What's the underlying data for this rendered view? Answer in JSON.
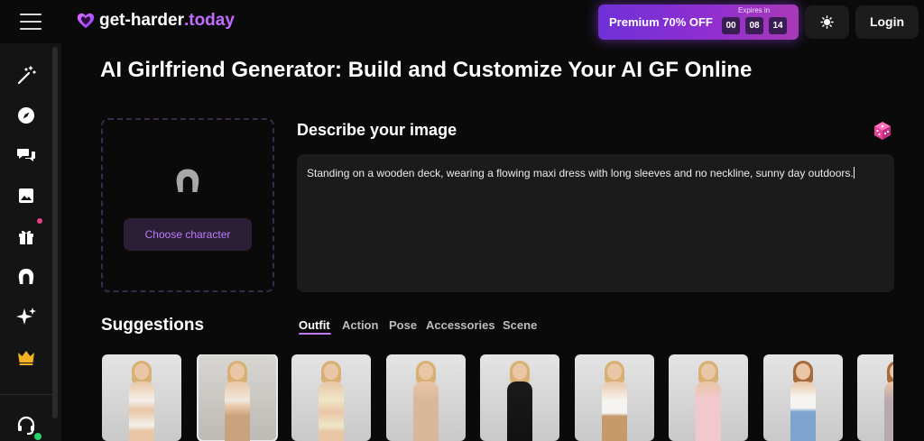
{
  "header": {
    "logo_text_a": "get-harder",
    "logo_text_b": ".today",
    "premium_label": "Premium 70% OFF",
    "expires_label": "Expires in",
    "countdown": [
      "00",
      "08",
      "14"
    ],
    "login_label": "Login",
    "icons": {
      "menu": "hamburger-icon",
      "theme": "sun-icon"
    }
  },
  "sidebar": {
    "items": [
      {
        "icon": "magic-wand-icon"
      },
      {
        "icon": "compass-icon"
      },
      {
        "icon": "chat-icon"
      },
      {
        "icon": "image-icon"
      },
      {
        "icon": "gift-icon",
        "has_notification": true
      },
      {
        "icon": "character-icon"
      },
      {
        "icon": "sparkles-icon"
      },
      {
        "icon": "crown-icon"
      }
    ],
    "support_icon": "headset-icon"
  },
  "main": {
    "title": "AI Girlfriend Generator: Build and Customize Your AI GF Online",
    "choose_character_label": "Choose character",
    "describe_title": "Describe your image",
    "prompt_value": "Standing on a wooden deck, wearing a flowing maxi dress with long sleeves and no neckline, sunny day outdoors.",
    "suggestions_title": "Suggestions",
    "tabs": [
      {
        "label": "Outfit",
        "active": true
      },
      {
        "label": "Action"
      },
      {
        "label": "Pose"
      },
      {
        "label": "Accessories"
      },
      {
        "label": "Scene"
      }
    ],
    "thumbnails": [
      {
        "outfit": "white-lingerie",
        "selected": false
      },
      {
        "outfit": "beige-shapewear",
        "selected": true
      },
      {
        "outfit": "cream-lace-lingerie",
        "selected": false
      },
      {
        "outfit": "nude-off-shoulder",
        "selected": false
      },
      {
        "outfit": "black-latex-suit",
        "selected": false
      },
      {
        "outfit": "white-crop-tan-skirt",
        "selected": false
      },
      {
        "outfit": "pink-satin-robe",
        "selected": false
      },
      {
        "outfit": "white-top-blue-jeans",
        "selected": false
      },
      {
        "outfit": "grey-outfit",
        "selected": false
      }
    ]
  },
  "colors": {
    "accent": "#c07aff",
    "premium_start": "#6f30d8",
    "premium_end": "#a93ab6",
    "notification": "#e83f8c",
    "online": "#2ad16a",
    "background": "#0a0a0a"
  }
}
